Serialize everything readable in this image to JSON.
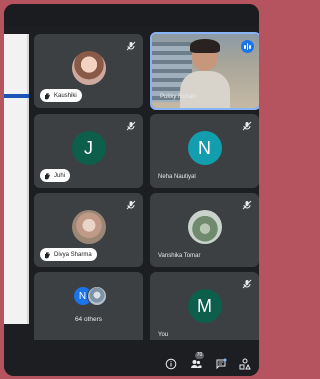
{
  "participants": [
    {
      "name": "Kaushiki",
      "label_style": "pill",
      "hand_raised": true,
      "avatar_type": "photo",
      "muted": true
    },
    {
      "name": "Pukky Rohan",
      "label_style": "plain",
      "hand_raised": false,
      "avatar_type": "video",
      "muted": false,
      "speaking": true
    },
    {
      "name": "Juhi",
      "label_style": "pill",
      "hand_raised": true,
      "avatar_type": "initial",
      "initial": "J",
      "avatar_color": "#0d5e4a",
      "muted": true
    },
    {
      "name": "Neha Nautiyal",
      "label_style": "plain",
      "hand_raised": false,
      "avatar_type": "initial",
      "initial": "N",
      "avatar_color": "#129eaf",
      "muted": true
    },
    {
      "name": "Divya Sharma",
      "label_style": "pill",
      "hand_raised": true,
      "avatar_type": "photo",
      "muted": true
    },
    {
      "name": "Vanshika Tomar",
      "label_style": "plain",
      "hand_raised": false,
      "avatar_type": "photo",
      "muted": true
    },
    {
      "name": "You",
      "label_style": "plain",
      "hand_raised": false,
      "avatar_type": "initial",
      "initial": "M",
      "avatar_color": "#0d5e4a",
      "muted": true
    }
  ],
  "others_tile": {
    "label": "64 others",
    "initial": "N",
    "initial_color": "#1a73e8"
  },
  "toolbar": {
    "participants_count": "70",
    "icons": [
      "info-icon",
      "people-icon",
      "chat-icon",
      "activities-icon"
    ]
  },
  "colors": {
    "background": "#b5545f",
    "tile": "#3c4043",
    "accent": "#8ab4f8"
  }
}
